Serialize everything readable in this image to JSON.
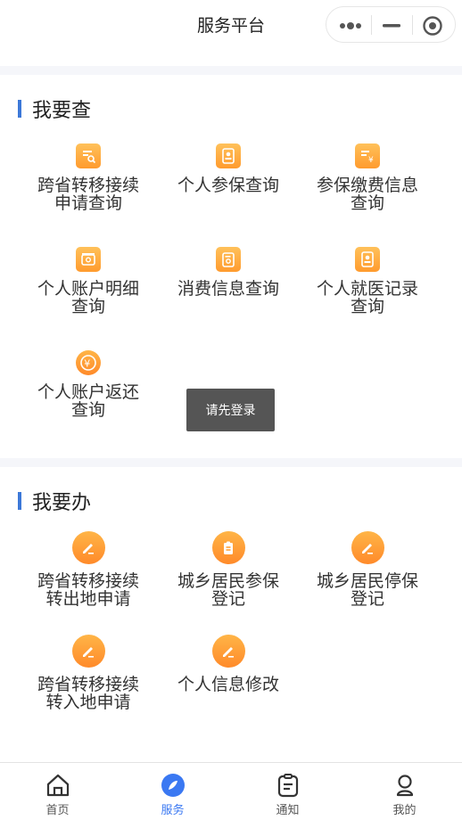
{
  "header": {
    "title": "服务平台"
  },
  "query_section": {
    "title": "我要查",
    "items": [
      {
        "label": "跨省转移接续申请查询",
        "icon": "search-doc-icon"
      },
      {
        "label": "个人参保查询",
        "icon": "person-card-icon"
      },
      {
        "label": "参保缴费信息查询",
        "icon": "yuan-doc-icon"
      },
      {
        "label": "个人账户明细查询",
        "icon": "wallet-search-icon"
      },
      {
        "label": "消费信息查询",
        "icon": "search-doc-icon"
      },
      {
        "label": "个人就医记录查询",
        "icon": "person-card-icon"
      },
      {
        "label": "个人账户返还查询",
        "icon": "yuan-return-icon"
      }
    ]
  },
  "toast": {
    "text": "请先登录"
  },
  "handle_section": {
    "title": "我要办",
    "items": [
      {
        "label": "跨省转移接续转出地申请",
        "icon": "edit-icon"
      },
      {
        "label": "城乡居民参保登记",
        "icon": "register-icon"
      },
      {
        "label": "城乡居民停保登记",
        "icon": "edit-icon"
      },
      {
        "label": "跨省转移接续转入地申请",
        "icon": "edit-icon"
      },
      {
        "label": "个人信息修改",
        "icon": "edit-icon"
      }
    ]
  },
  "tabbar": {
    "tabs": [
      {
        "label": "首页",
        "icon": "home-icon",
        "active": false
      },
      {
        "label": "服务",
        "icon": "compass-icon",
        "active": true
      },
      {
        "label": "通知",
        "icon": "clipboard-icon",
        "active": false
      },
      {
        "label": "我的",
        "icon": "user-icon",
        "active": false
      }
    ],
    "active_color": "#3a78f2"
  },
  "colors": {
    "accent": "#3c78d8",
    "icon_orange": "#ff9b2e"
  }
}
